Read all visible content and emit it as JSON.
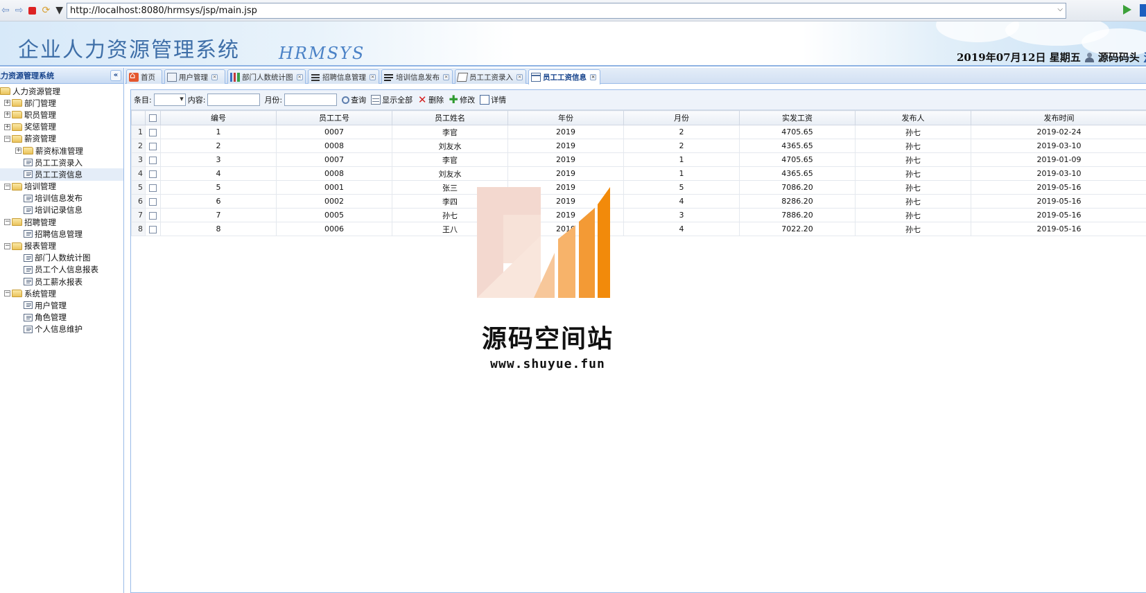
{
  "browser": {
    "url": "http://localhost:8080/hrmsys/jsp/main.jsp"
  },
  "header": {
    "title": "企业人力资源管理系统",
    "subtitle": "HRMSYS",
    "date": "2019年07月12日 星期五",
    "username": "源码码头",
    "logout_label": "注销"
  },
  "sidebar": {
    "title": "人力资源管理系统",
    "collapse_label": "«",
    "tree": [
      {
        "label": "人力资源管理",
        "type": "folder",
        "level": 0,
        "expanded": true
      },
      {
        "label": "部门管理",
        "type": "folder",
        "level": 1,
        "expanded": false
      },
      {
        "label": "职员管理",
        "type": "folder",
        "level": 1,
        "expanded": false
      },
      {
        "label": "奖惩管理",
        "type": "folder",
        "level": 1,
        "expanded": false
      },
      {
        "label": "薪资管理",
        "type": "folder",
        "level": 1,
        "expanded": true
      },
      {
        "label": "薪资标准管理",
        "type": "folder",
        "level": 2,
        "expanded": false
      },
      {
        "label": "员工工资录入",
        "type": "leaf",
        "level": 2
      },
      {
        "label": "员工工资信息",
        "type": "leaf",
        "level": 2,
        "selected": true
      },
      {
        "label": "培训管理",
        "type": "folder",
        "level": 1,
        "expanded": true
      },
      {
        "label": "培训信息发布",
        "type": "leaf",
        "level": 2
      },
      {
        "label": "培训记录信息",
        "type": "leaf",
        "level": 2
      },
      {
        "label": "招聘管理",
        "type": "folder",
        "level": 1,
        "expanded": true
      },
      {
        "label": "招聘信息管理",
        "type": "leaf",
        "level": 2
      },
      {
        "label": "报表管理",
        "type": "folder",
        "level": 1,
        "expanded": true
      },
      {
        "label": "部门人数统计图",
        "type": "leaf",
        "level": 2
      },
      {
        "label": "员工个人信息报表",
        "type": "leaf",
        "level": 2
      },
      {
        "label": "员工薪水报表",
        "type": "leaf",
        "level": 2
      },
      {
        "label": "系统管理",
        "type": "folder",
        "level": 1,
        "expanded": true
      },
      {
        "label": "用户管理",
        "type": "leaf",
        "level": 2
      },
      {
        "label": "角色管理",
        "type": "leaf",
        "level": 2
      },
      {
        "label": "个人信息维护",
        "type": "leaf",
        "level": 2
      }
    ]
  },
  "tabs": [
    {
      "label": "首页",
      "icon": "home-icon",
      "closable": false
    },
    {
      "label": "用户管理",
      "icon": "user-icon",
      "closable": true
    },
    {
      "label": "部门人数统计图",
      "icon": "chart-icon",
      "closable": true
    },
    {
      "label": "招聘信息管理",
      "icon": "list-icon",
      "closable": true
    },
    {
      "label": "培训信息发布",
      "icon": "doc-icon",
      "closable": true
    },
    {
      "label": "员工工资录入",
      "icon": "edit-icon",
      "closable": true
    },
    {
      "label": "员工工资信息",
      "icon": "table-icon",
      "closable": true,
      "active": true
    }
  ],
  "toolbar": {
    "entry_label": "条目:",
    "entry_value": "",
    "content_label": "内容:",
    "content_value": "",
    "month_label": "月份:",
    "month_value": "",
    "search_label": "查询",
    "show_all_label": "显示全部",
    "delete_label": "删除",
    "modify_label": "修改",
    "detail_label": "详情"
  },
  "grid": {
    "columns": [
      "编号",
      "员工工号",
      "员工姓名",
      "年份",
      "月份",
      "实发工资",
      "发布人",
      "发布时间"
    ],
    "rows": [
      [
        "1",
        "0007",
        "李官",
        "2019",
        "2",
        "4705.65",
        "孙七",
        "2019-02-24"
      ],
      [
        "2",
        "0008",
        "刘友水",
        "2019",
        "2",
        "4365.65",
        "孙七",
        "2019-03-10"
      ],
      [
        "3",
        "0007",
        "李官",
        "2019",
        "1",
        "4705.65",
        "孙七",
        "2019-01-09"
      ],
      [
        "4",
        "0008",
        "刘友水",
        "2019",
        "1",
        "4365.65",
        "孙七",
        "2019-03-10"
      ],
      [
        "5",
        "0001",
        "张三",
        "2019",
        "5",
        "7086.20",
        "孙七",
        "2019-05-16"
      ],
      [
        "6",
        "0002",
        "李四",
        "2019",
        "4",
        "8286.20",
        "孙七",
        "2019-05-16"
      ],
      [
        "7",
        "0005",
        "孙七",
        "2019",
        "3",
        "7886.20",
        "孙七",
        "2019-05-16"
      ],
      [
        "8",
        "0006",
        "王八",
        "2019",
        "4",
        "7022.20",
        "孙七",
        "2019-05-16"
      ]
    ]
  },
  "watermark": {
    "text": "源码空间站",
    "url": "www.shuyue.fun"
  },
  "colors": {
    "accent": "#99bbe8",
    "title_blue": "#3f6fa8",
    "watermark_orange": "#f28a0a"
  }
}
